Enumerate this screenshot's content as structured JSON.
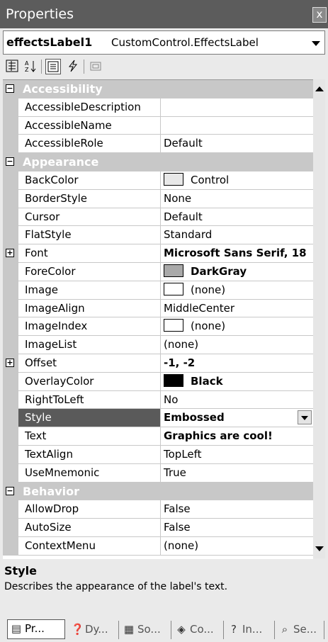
{
  "window": {
    "title": "Properties",
    "close_glyph": "x"
  },
  "object_selector": {
    "name": "effectsLabel1",
    "type": "CustomControl.EffectsLabel"
  },
  "toolbar": {
    "categorized_icon": "categorized-icon",
    "alphabetical_icon": "alphabetical-icon",
    "properties_icon": "properties-icon",
    "events_icon": "events-icon",
    "property_pages_icon": "property-pages-icon"
  },
  "categories": [
    {
      "name": "Accessibility",
      "expanded": true
    },
    {
      "name": "Appearance",
      "expanded": true
    },
    {
      "name": "Behavior",
      "expanded": true
    }
  ],
  "properties": [
    {
      "name": "AccessibleDescription",
      "value": ""
    },
    {
      "name": "AccessibleName",
      "value": ""
    },
    {
      "name": "AccessibleRole",
      "value": "Default"
    },
    {
      "name": "BackColor",
      "value": "Control",
      "swatch": "#e8e8e8"
    },
    {
      "name": "BorderStyle",
      "value": "None"
    },
    {
      "name": "Cursor",
      "value": "Default"
    },
    {
      "name": "FlatStyle",
      "value": "Standard"
    },
    {
      "name": "Font",
      "value": "Microsoft Sans Serif, 18",
      "bold": true,
      "expandable": true
    },
    {
      "name": "ForeColor",
      "value": "DarkGray",
      "bold": true,
      "swatch": "#a9a9a9"
    },
    {
      "name": "Image",
      "value": "(none)",
      "swatch": "#ffffff"
    },
    {
      "name": "ImageAlign",
      "value": "MiddleCenter"
    },
    {
      "name": "ImageIndex",
      "value": "(none)",
      "swatch": "#ffffff"
    },
    {
      "name": "ImageList",
      "value": "(none)"
    },
    {
      "name": "Offset",
      "value": "-1, -2",
      "bold": true,
      "expandable": true
    },
    {
      "name": "OverlayColor",
      "value": "Black",
      "bold": true,
      "swatch": "#000000"
    },
    {
      "name": "RightToLeft",
      "value": "No"
    },
    {
      "name": "Style",
      "value": "Embossed",
      "bold": true,
      "selected": true
    },
    {
      "name": "Text",
      "value": "Graphics are cool!",
      "bold": true
    },
    {
      "name": "TextAlign",
      "value": "TopLeft"
    },
    {
      "name": "UseMnemonic",
      "value": "True"
    },
    {
      "name": "AllowDrop",
      "value": "False"
    },
    {
      "name": "AutoSize",
      "value": "False"
    },
    {
      "name": "ContextMenu",
      "value": "(none)"
    }
  ],
  "description": {
    "title": "Style",
    "text": "Describes the appearance of the label's text."
  },
  "tabs": [
    {
      "label": "Pr...",
      "icon": "properties-tab-icon",
      "active": true
    },
    {
      "label": "Dy...",
      "icon": "dynamic-help-icon"
    },
    {
      "label": "So...",
      "icon": "solution-explorer-icon"
    },
    {
      "label": "Co...",
      "icon": "contents-icon"
    },
    {
      "label": "In...",
      "icon": "index-icon"
    },
    {
      "label": "Se...",
      "icon": "search-icon"
    }
  ]
}
